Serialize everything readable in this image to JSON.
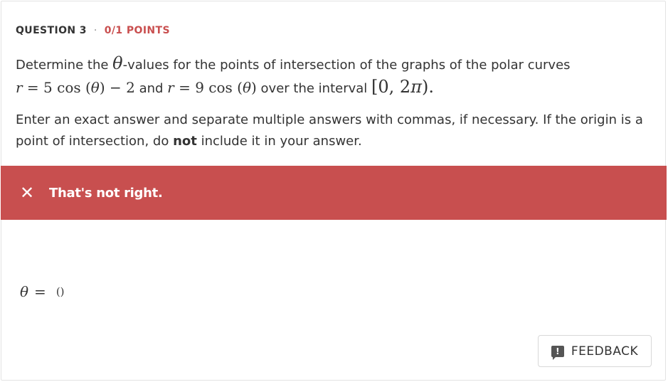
{
  "header": {
    "question_label": "QUESTION 3",
    "separator": "·",
    "points": "0/1 POINTS"
  },
  "question": {
    "line1_text": "Determine the ",
    "theta": "θ",
    "line1_rest": "-values for the points of intersection of the graphs of the polar curves",
    "curve1_r": "r",
    "curve1_eq": " = 5 cos (",
    "curve1_theta": "θ",
    "curve1_tail": ") − 2",
    "and_word": " and ",
    "curve2_r": "r",
    "curve2_eq": " = 9 cos (",
    "curve2_theta": "θ",
    "curve2_tail": ")",
    "interval_lead": " over the interval ",
    "interval_open": "[0, 2",
    "interval_pi": "π",
    "interval_close": ").",
    "instructions_1": "Enter an exact answer and separate multiple answers with commas, if necessary. If the origin is a point of intersection, do ",
    "instructions_bold": "not",
    "instructions_2": " include it in your answer."
  },
  "result": {
    "icon": "close-icon",
    "message": "That's not right.",
    "color": "#c84f4f"
  },
  "answer": {
    "variable": "θ",
    "equals": "=",
    "value": "()"
  },
  "feedback_button": {
    "icon": "feedback-icon",
    "icon_glyph": "!",
    "label": "FEEDBACK"
  }
}
